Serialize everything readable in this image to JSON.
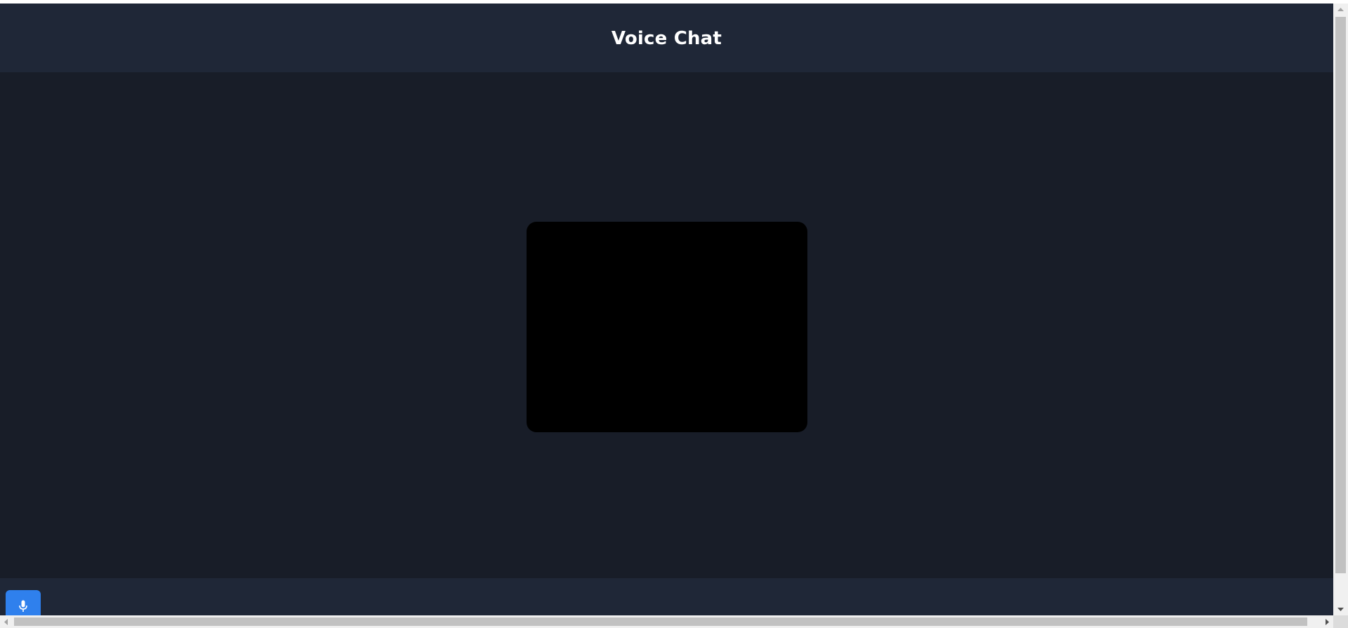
{
  "header": {
    "title": "Voice Chat"
  },
  "main": {
    "video_placeholder": ""
  },
  "footer": {
    "mic_button": {
      "icon": "microphone-icon"
    }
  },
  "colors": {
    "header_bg": "#1f2737",
    "stage_bg": "#181d28",
    "video_bg": "#000000",
    "accent": "#2f80ed"
  }
}
